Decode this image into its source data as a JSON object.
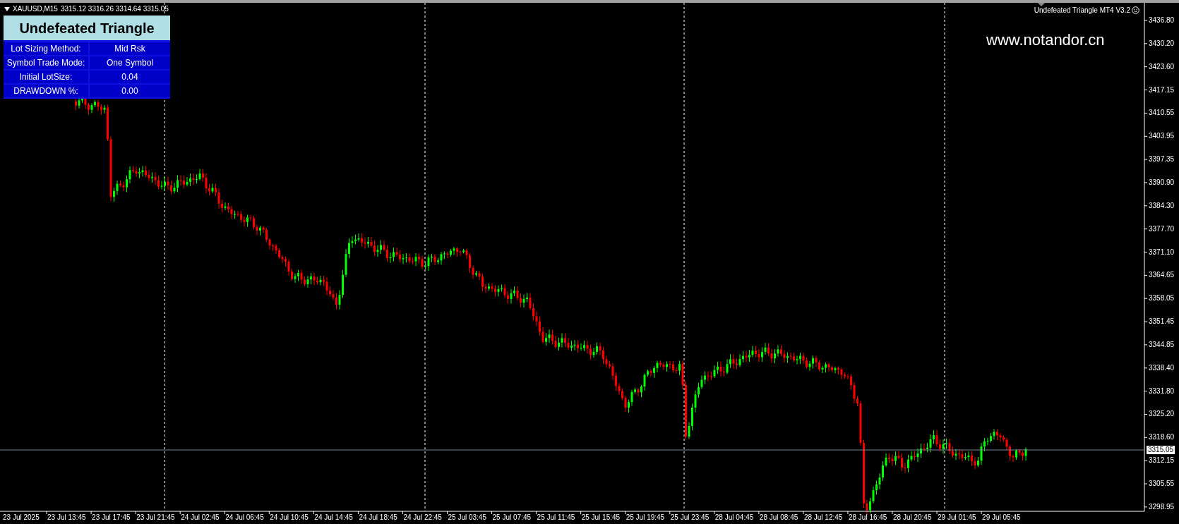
{
  "chart_header": {
    "symbol": "XAUUSD,M15",
    "ohlc": "3315.12 3316.26 3314.64 3315.05"
  },
  "info_panel": {
    "title": "Undefeated Triangle",
    "rows": [
      {
        "label": "Lot Sizing Method:",
        "value": "Mid Rsk"
      },
      {
        "label": "Symbol Trade Mode:",
        "value": "One Symbol"
      },
      {
        "label": "Initial LotSize:",
        "value": "0.04"
      },
      {
        "label": "DRAWDOWN %:",
        "value": "0.00"
      }
    ]
  },
  "expert_label": "Undefeated Triangle MT4 V3.2",
  "website": "www.notandor.cn",
  "price_axis": {
    "labels": [
      "3436.80",
      "3430.20",
      "3423.60",
      "3417.15",
      "3410.55",
      "3403.95",
      "3397.35",
      "3390.90",
      "3384.30",
      "3377.70",
      "3371.10",
      "3364.65",
      "3358.05",
      "3351.45",
      "3344.85",
      "3338.40",
      "3331.80",
      "3325.20",
      "3318.60",
      "3312.15",
      "3305.55",
      "3298.95"
    ],
    "current_price": "3315.05"
  },
  "time_axis": {
    "labels": [
      "23 Jul 2025",
      "23 Jul 13:45",
      "23 Jul 17:45",
      "23 Jul 21:45",
      "24 Jul 02:45",
      "24 Jul 06:45",
      "24 Jul 10:45",
      "24 Jul 14:45",
      "24 Jul 18:45",
      "24 Jul 22:45",
      "25 Jul 03:45",
      "25 Jul 07:45",
      "25 Jul 11:45",
      "25 Jul 15:45",
      "25 Jul 19:45",
      "25 Jul 23:45",
      "28 Jul 04:45",
      "28 Jul 08:45",
      "28 Jul 12:45",
      "28 Jul 16:45",
      "28 Jul 20:45",
      "29 Jul 01:45",
      "29 Jul 05:45"
    ]
  }
}
